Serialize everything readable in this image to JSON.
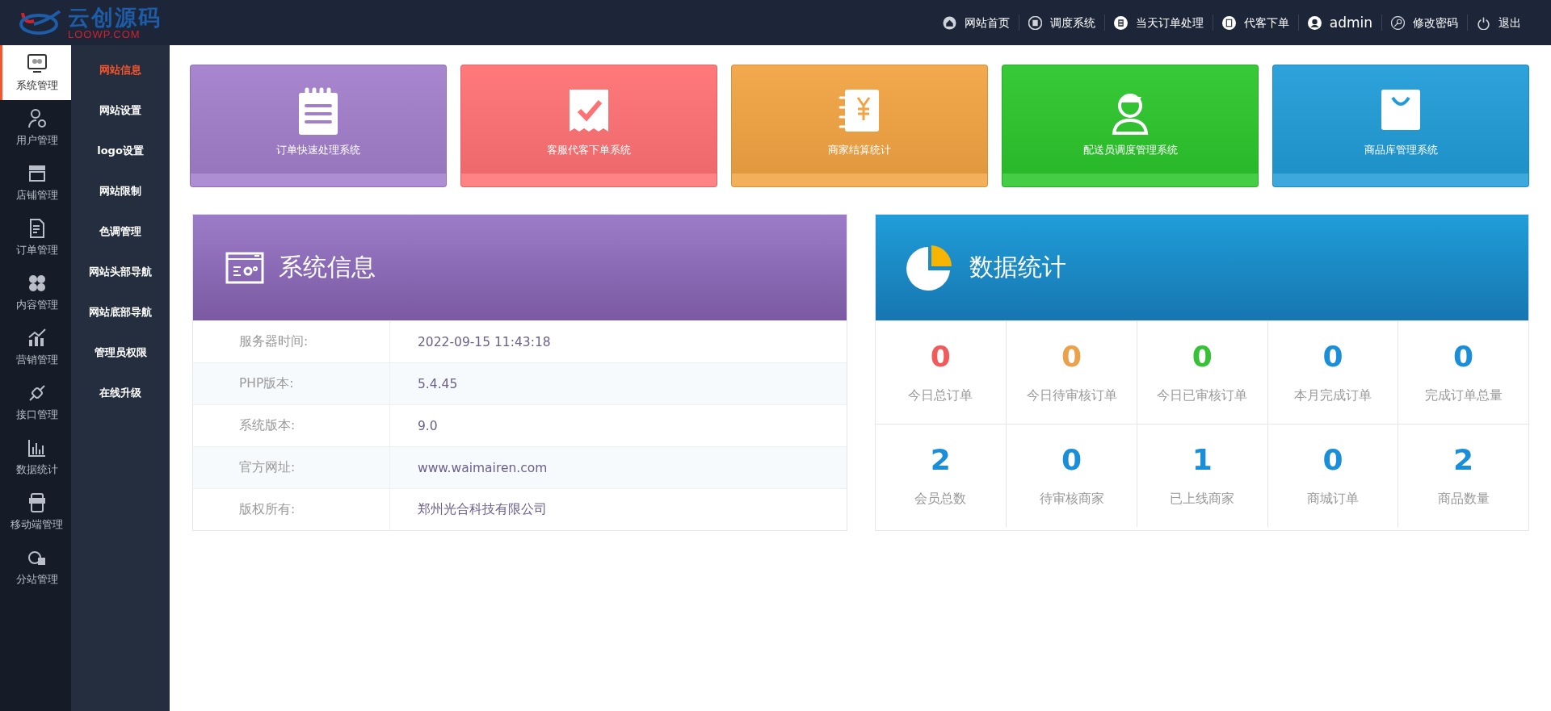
{
  "logo": {
    "title": "云创源码",
    "subtitle": "LOOWP.COM"
  },
  "top_nav": [
    {
      "label": "网站首页"
    },
    {
      "label": "调度系统"
    },
    {
      "label": "当天订单处理"
    },
    {
      "label": "代客下单"
    },
    {
      "label": "admin"
    },
    {
      "label": "修改密码"
    },
    {
      "label": "退出"
    }
  ],
  "sidebar": {
    "items": [
      {
        "label": "系统管理",
        "selected": true
      },
      {
        "label": "用户管理",
        "selected": false
      },
      {
        "label": "店铺管理",
        "selected": false
      },
      {
        "label": "订单管理",
        "selected": false
      },
      {
        "label": "内容管理",
        "selected": false
      },
      {
        "label": "营销管理",
        "selected": false
      },
      {
        "label": "接口管理",
        "selected": false
      },
      {
        "label": "数据统计",
        "selected": false
      },
      {
        "label": "移动端管理",
        "selected": false
      },
      {
        "label": "分站管理",
        "selected": false
      }
    ]
  },
  "submenu": {
    "items": [
      {
        "label": "网站信息",
        "selected": true
      },
      {
        "label": "网站设置",
        "selected": false
      },
      {
        "label": "logo设置",
        "selected": false
      },
      {
        "label": "网站限制",
        "selected": false
      },
      {
        "label": "色调管理",
        "selected": false
      },
      {
        "label": "网站头部导航",
        "selected": false
      },
      {
        "label": "网站底部导航",
        "selected": false
      },
      {
        "label": "管理员权限",
        "selected": false
      },
      {
        "label": "在线升级",
        "selected": false
      }
    ]
  },
  "cards": [
    {
      "label": "订单快速处理系统",
      "color": "#a27fcc"
    },
    {
      "label": "客服代客下单系统",
      "color": "#ff7173"
    },
    {
      "label": "商家结算统计",
      "color": "#f2a443"
    },
    {
      "label": "配送员调度管理系统",
      "color": "#2cc62c"
    },
    {
      "label": "商品库管理系统",
      "color": "#219cd8"
    }
  ],
  "system_info": {
    "title": "系统信息",
    "rows": [
      {
        "label": "服务器时间:",
        "value": "2022-09-15 11:43:18"
      },
      {
        "label": "PHP版本:",
        "value": "5.4.45"
      },
      {
        "label": "系统版本:",
        "value": "9.0"
      },
      {
        "label": "官方网址:",
        "value": "www.waimairen.com"
      },
      {
        "label": "版权所有:",
        "value": "郑州光合科技有限公司"
      }
    ]
  },
  "data_stats": {
    "title": "数据统计",
    "items": [
      {
        "value": "0",
        "label": "今日总订单",
        "color": "#f05a5a"
      },
      {
        "value": "0",
        "label": "今日待审核订单",
        "color": "#eba04a"
      },
      {
        "value": "0",
        "label": "今日已审核订单",
        "color": "#36c136"
      },
      {
        "value": "0",
        "label": "本月完成订单",
        "color": "#1a8ed8"
      },
      {
        "value": "0",
        "label": "完成订单总量",
        "color": "#1a8ed8"
      },
      {
        "value": "2",
        "label": "会员总数",
        "color": "#1a8ed8"
      },
      {
        "value": "0",
        "label": "待审核商家",
        "color": "#1a8ed8"
      },
      {
        "value": "1",
        "label": "已上线商家",
        "color": "#1a8ed8"
      },
      {
        "value": "0",
        "label": "商城订单",
        "color": "#1a8ed8"
      },
      {
        "value": "2",
        "label": "商品数量",
        "color": "#1a8ed8"
      }
    ]
  }
}
